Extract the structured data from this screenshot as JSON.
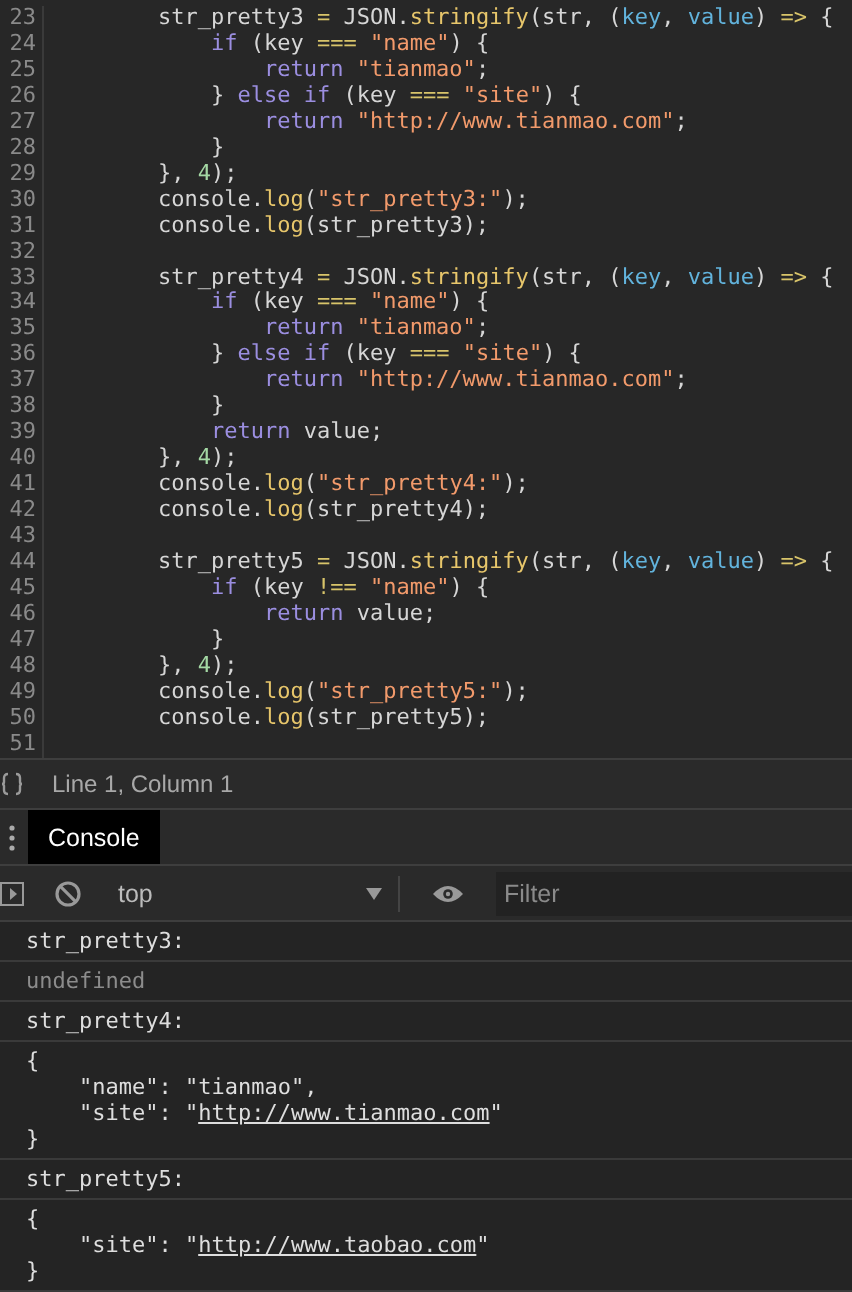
{
  "editor": {
    "lines": [
      {
        "number": "23",
        "tokens": [
          {
            "kind": "plain",
            "text": "        str_pretty3 "
          },
          {
            "kind": "operator",
            "text": "="
          },
          {
            "kind": "plain",
            "text": " JSON."
          },
          {
            "kind": "function",
            "text": "stringify"
          },
          {
            "kind": "plain",
            "text": "(str, ("
          },
          {
            "kind": "param",
            "text": "key"
          },
          {
            "kind": "plain",
            "text": ", "
          },
          {
            "kind": "param",
            "text": "value"
          },
          {
            "kind": "plain",
            "text": ") "
          },
          {
            "kind": "operator",
            "text": "=>"
          },
          {
            "kind": "plain",
            "text": " {"
          }
        ]
      },
      {
        "number": "24",
        "tokens": [
          {
            "kind": "keyword",
            "text": "            if"
          },
          {
            "kind": "plain",
            "text": " (key "
          },
          {
            "kind": "operator",
            "text": "==="
          },
          {
            "kind": "string",
            "text": " \"name\""
          },
          {
            "kind": "plain",
            "text": ") {"
          }
        ]
      },
      {
        "number": "25",
        "tokens": [
          {
            "kind": "keyword",
            "text": "                return"
          },
          {
            "kind": "string",
            "text": " \"tianmao\""
          },
          {
            "kind": "plain",
            "text": ";"
          }
        ]
      },
      {
        "number": "26",
        "tokens": [
          {
            "kind": "plain",
            "text": "            } "
          },
          {
            "kind": "keyword",
            "text": "else if"
          },
          {
            "kind": "plain",
            "text": " (key "
          },
          {
            "kind": "operator",
            "text": "==="
          },
          {
            "kind": "string",
            "text": " \"site\""
          },
          {
            "kind": "plain",
            "text": ") {"
          }
        ]
      },
      {
        "number": "27",
        "tokens": [
          {
            "kind": "keyword",
            "text": "                return"
          },
          {
            "kind": "string",
            "text": " \"http://www.tianmao.com\""
          },
          {
            "kind": "plain",
            "text": ";"
          }
        ]
      },
      {
        "number": "28",
        "tokens": [
          {
            "kind": "plain",
            "text": "            }"
          }
        ]
      },
      {
        "number": "29",
        "tokens": [
          {
            "kind": "plain",
            "text": "        }, "
          },
          {
            "kind": "number",
            "text": "4"
          },
          {
            "kind": "plain",
            "text": ");"
          }
        ]
      },
      {
        "number": "30",
        "tokens": [
          {
            "kind": "plain",
            "text": "        console."
          },
          {
            "kind": "function",
            "text": "log"
          },
          {
            "kind": "plain",
            "text": "("
          },
          {
            "kind": "string",
            "text": "\"str_pretty3:\""
          },
          {
            "kind": "plain",
            "text": ");"
          }
        ]
      },
      {
        "number": "31",
        "tokens": [
          {
            "kind": "plain",
            "text": "        console."
          },
          {
            "kind": "function",
            "text": "log"
          },
          {
            "kind": "plain",
            "text": "(str_pretty3);"
          }
        ]
      },
      {
        "number": "32"
      },
      {
        "number": "33",
        "tokens": [
          {
            "kind": "plain",
            "text": "        str_pretty4 "
          },
          {
            "kind": "operator",
            "text": "="
          },
          {
            "kind": "plain",
            "text": " JSON."
          },
          {
            "kind": "function",
            "text": "stringify"
          },
          {
            "kind": "plain",
            "text": "(str, ("
          },
          {
            "kind": "param",
            "text": "key"
          },
          {
            "kind": "plain",
            "text": ", "
          },
          {
            "kind": "param",
            "text": "value"
          },
          {
            "kind": "plain",
            "text": ") "
          },
          {
            "kind": "operator",
            "text": "=>"
          },
          {
            "kind": "plain",
            "text": " {"
          }
        ]
      },
      {
        "number": "34",
        "tokens": [
          {
            "kind": "keyword",
            "text": "            if"
          },
          {
            "kind": "plain",
            "text": " (key "
          },
          {
            "kind": "operator",
            "text": "==="
          },
          {
            "kind": "string",
            "text": " \"name\""
          },
          {
            "kind": "plain",
            "text": ") {"
          }
        ]
      },
      {
        "number": "35",
        "tokens": [
          {
            "kind": "keyword",
            "text": "                return"
          },
          {
            "kind": "string",
            "text": " \"tianmao\""
          },
          {
            "kind": "plain",
            "text": ";"
          }
        ]
      },
      {
        "number": "36",
        "tokens": [
          {
            "kind": "plain",
            "text": "            } "
          },
          {
            "kind": "keyword",
            "text": "else if"
          },
          {
            "kind": "plain",
            "text": " (key "
          },
          {
            "kind": "operator",
            "text": "==="
          },
          {
            "kind": "string",
            "text": " \"site\""
          },
          {
            "kind": "plain",
            "text": ") {"
          }
        ]
      },
      {
        "number": "37",
        "tokens": [
          {
            "kind": "keyword",
            "text": "                return"
          },
          {
            "kind": "string",
            "text": " \"http://www.tianmao.com\""
          },
          {
            "kind": "plain",
            "text": ";"
          }
        ]
      },
      {
        "number": "38",
        "tokens": [
          {
            "kind": "plain",
            "text": "            }"
          }
        ]
      },
      {
        "number": "39",
        "tokens": [
          {
            "kind": "keyword",
            "text": "            return"
          },
          {
            "kind": "plain",
            "text": " value;"
          }
        ]
      },
      {
        "number": "40",
        "tokens": [
          {
            "kind": "plain",
            "text": "        }, "
          },
          {
            "kind": "number",
            "text": "4"
          },
          {
            "kind": "plain",
            "text": ");"
          }
        ]
      },
      {
        "number": "41",
        "tokens": [
          {
            "kind": "plain",
            "text": "        console."
          },
          {
            "kind": "function",
            "text": "log"
          },
          {
            "kind": "plain",
            "text": "("
          },
          {
            "kind": "string",
            "text": "\"str_pretty4:\""
          },
          {
            "kind": "plain",
            "text": ");"
          }
        ]
      },
      {
        "number": "42",
        "tokens": [
          {
            "kind": "plain",
            "text": "        console."
          },
          {
            "kind": "function",
            "text": "log"
          },
          {
            "kind": "plain",
            "text": "(str_pretty4);"
          }
        ]
      },
      {
        "number": "43"
      },
      {
        "number": "44",
        "tokens": [
          {
            "kind": "plain",
            "text": "        str_pretty5 "
          },
          {
            "kind": "operator",
            "text": "="
          },
          {
            "kind": "plain",
            "text": " JSON."
          },
          {
            "kind": "function",
            "text": "stringify"
          },
          {
            "kind": "plain",
            "text": "(str, ("
          },
          {
            "kind": "param",
            "text": "key"
          },
          {
            "kind": "plain",
            "text": ", "
          },
          {
            "kind": "param",
            "text": "value"
          },
          {
            "kind": "plain",
            "text": ") "
          },
          {
            "kind": "operator",
            "text": "=>"
          },
          {
            "kind": "plain",
            "text": " {"
          }
        ]
      },
      {
        "number": "45",
        "tokens": [
          {
            "kind": "keyword",
            "text": "            if"
          },
          {
            "kind": "plain",
            "text": " (key "
          },
          {
            "kind": "operator",
            "text": "!=="
          },
          {
            "kind": "string",
            "text": " \"name\""
          },
          {
            "kind": "plain",
            "text": ") {"
          }
        ]
      },
      {
        "number": "46",
        "tokens": [
          {
            "kind": "keyword",
            "text": "                return"
          },
          {
            "kind": "plain",
            "text": " value;"
          }
        ]
      },
      {
        "number": "47",
        "tokens": [
          {
            "kind": "plain",
            "text": "            }"
          }
        ]
      },
      {
        "number": "48",
        "tokens": [
          {
            "kind": "plain",
            "text": "        }, "
          },
          {
            "kind": "number",
            "text": "4"
          },
          {
            "kind": "plain",
            "text": ");"
          }
        ]
      },
      {
        "number": "49",
        "tokens": [
          {
            "kind": "plain",
            "text": "        console."
          },
          {
            "kind": "function",
            "text": "log"
          },
          {
            "kind": "plain",
            "text": "("
          },
          {
            "kind": "string",
            "text": "\"str_pretty5:\""
          },
          {
            "kind": "plain",
            "text": ");"
          }
        ]
      },
      {
        "number": "50",
        "tokens": [
          {
            "kind": "plain",
            "text": "        console."
          },
          {
            "kind": "function",
            "text": "log"
          },
          {
            "kind": "plain",
            "text": "(str_pretty5);"
          }
        ]
      },
      {
        "number": "51"
      }
    ]
  },
  "status_bar": {
    "position": "Line 1, Column 1"
  },
  "drawer_tabs": [
    {
      "label": "Console",
      "selected": true
    }
  ],
  "toolbar": {
    "context": "top",
    "filter": {
      "placeholder": "Filter"
    }
  },
  "messages": [
    {
      "kind": "log",
      "lines": [
        [
          {
            "kind": "text",
            "text": "str_pretty3:"
          }
        ]
      ]
    },
    {
      "kind": "value",
      "lines": [
        [
          {
            "kind": "text",
            "text": "undefined"
          }
        ]
      ]
    },
    {
      "kind": "log",
      "lines": [
        [
          {
            "kind": "text",
            "text": "str_pretty4:"
          }
        ]
      ]
    },
    {
      "kind": "log",
      "lines": [
        [
          {
            "kind": "text",
            "text": "{"
          }
        ],
        [
          {
            "kind": "text",
            "text": "    \"name\": \"tianmao\","
          }
        ],
        [
          {
            "kind": "text",
            "text": "    \"site\": \""
          },
          {
            "kind": "link",
            "text": "http://www.tianmao.com"
          },
          {
            "kind": "text",
            "text": "\""
          }
        ],
        [
          {
            "kind": "text",
            "text": "}"
          }
        ]
      ]
    },
    {
      "kind": "log",
      "lines": [
        [
          {
            "kind": "text",
            "text": "str_pretty5:"
          }
        ]
      ]
    },
    {
      "kind": "log",
      "lines": [
        [
          {
            "kind": "text",
            "text": "{"
          }
        ],
        [
          {
            "kind": "text",
            "text": "    \"site\": \""
          },
          {
            "kind": "link",
            "text": "http://www.taobao.com"
          },
          {
            "kind": "text",
            "text": "\""
          }
        ],
        [
          {
            "kind": "text",
            "text": "}"
          }
        ]
      ]
    }
  ]
}
